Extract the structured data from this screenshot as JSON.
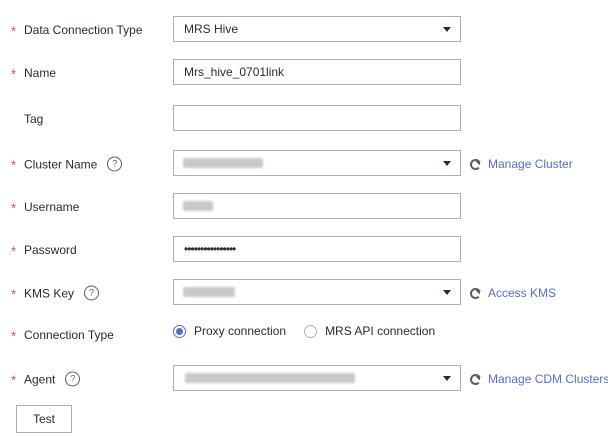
{
  "form": {
    "data_connection_type": {
      "label": "Data Connection Type",
      "value": "MRS Hive"
    },
    "name": {
      "label": "Name",
      "value": "Mrs_hive_0701link"
    },
    "tag": {
      "label": "Tag",
      "value": ""
    },
    "cluster_name": {
      "label": "Cluster Name",
      "link": "Manage Cluster"
    },
    "username": {
      "label": "Username"
    },
    "password": {
      "label": "Password",
      "value": "••••••••••••••••"
    },
    "kms_key": {
      "label": "KMS Key",
      "link": "Access KMS"
    },
    "connection_type": {
      "label": "Connection Type",
      "options": [
        "Proxy connection",
        "MRS API connection"
      ],
      "selected": "Proxy connection"
    },
    "agent": {
      "label": "Agent",
      "link": "Manage CDM Clusters"
    }
  },
  "actions": {
    "test_label": "Test"
  },
  "icons": {
    "help": "question-circle-icon",
    "refresh": "refresh-icon",
    "dropdown": "caret-down-icon"
  },
  "colors": {
    "required": "#e84a4a",
    "link": "#526ecc",
    "border": "#adb0b8"
  }
}
